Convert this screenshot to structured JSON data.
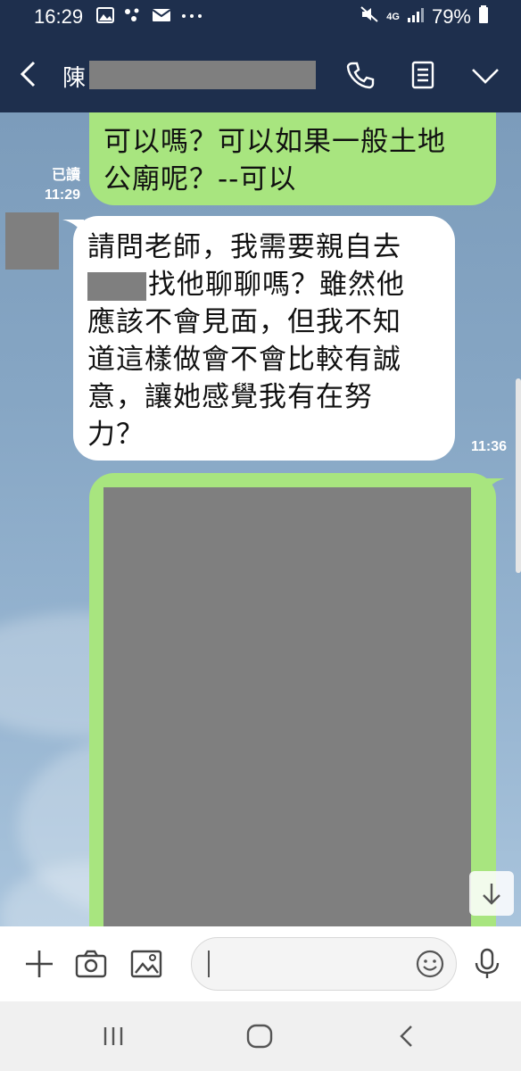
{
  "status_bar": {
    "time": "16:29",
    "network": "4G",
    "battery": "79%"
  },
  "header": {
    "contact_name": "陳"
  },
  "messages": {
    "outgoing_1": {
      "line_1": "可以嗎？可以如果一般土地",
      "line_2": "公廟呢？--可以",
      "read_status": "已讀",
      "time": "11:29"
    },
    "incoming_1": {
      "line_1": "請問老師，我需要親自去",
      "line_2_after_redaction": "找他聊聊嗎？雖然他",
      "line_3": "應該不會見面，但我不知",
      "line_4": "道這樣做會不會比較有誠",
      "line_5": "意，讓她感覺我有在努",
      "line_6": "力？",
      "time": "11:36"
    }
  },
  "input": {
    "value": "",
    "placeholder": ""
  },
  "colors": {
    "header_bg": "#1e2f4d",
    "outgoing_bubble": "#a8e57f",
    "incoming_bubble": "#ffffff",
    "redaction": "#7f7f7f"
  }
}
